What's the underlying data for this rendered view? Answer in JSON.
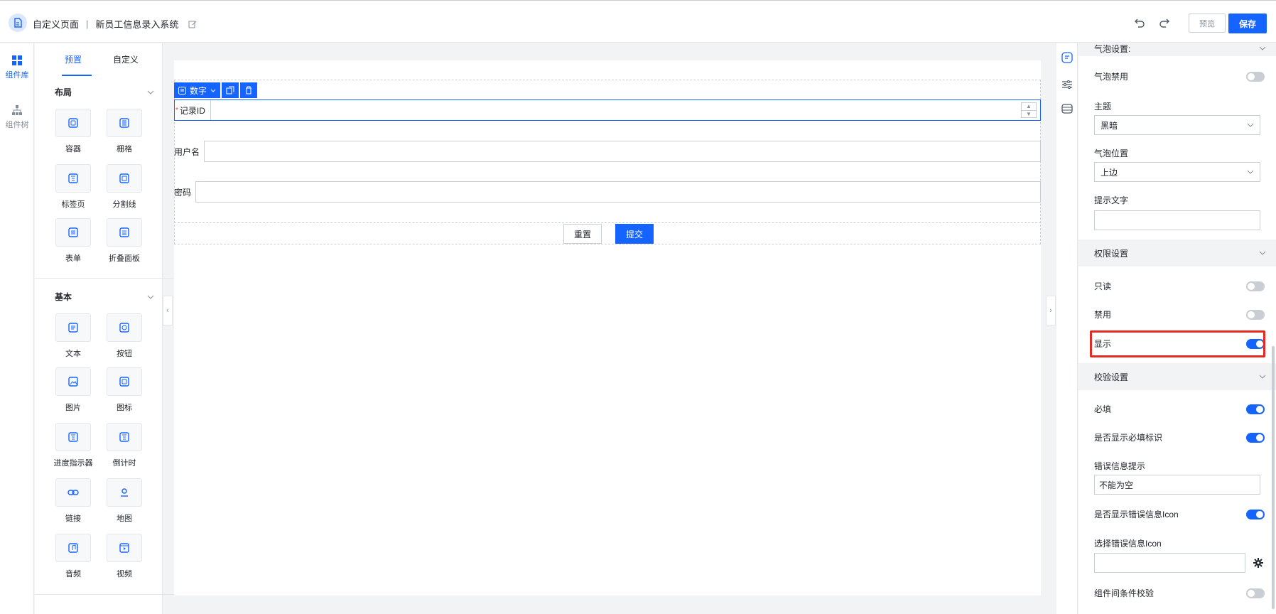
{
  "header": {
    "page_type": "自定义页面",
    "separator": "|",
    "system_name": "新员工信息录入系统",
    "preview_label": "预览",
    "save_label": "保存"
  },
  "left_rail": {
    "items": [
      {
        "label": "组件库",
        "icon": "grid-icon",
        "active": true
      },
      {
        "label": "组件树",
        "icon": "tree-icon",
        "active": false
      }
    ]
  },
  "palette": {
    "tabs": [
      "预置",
      "自定义"
    ],
    "sections": [
      {
        "title": "布局",
        "items": [
          {
            "label": "容器",
            "icon": "container-icon"
          },
          {
            "label": "栅格",
            "icon": "grid-columns-icon"
          },
          {
            "label": "标签页",
            "icon": "tabs-icon"
          },
          {
            "label": "分割线",
            "icon": "divider-icon"
          },
          {
            "label": "表单",
            "icon": "form-icon"
          },
          {
            "label": "折叠面板",
            "icon": "collapse-icon"
          }
        ]
      },
      {
        "title": "基本",
        "items": [
          {
            "label": "文本",
            "icon": "text-icon"
          },
          {
            "label": "按钮",
            "icon": "button-icon"
          },
          {
            "label": "图片",
            "icon": "image-icon"
          },
          {
            "label": "图标",
            "icon": "icon-icon"
          },
          {
            "label": "进度指示器",
            "icon": "progress-icon"
          },
          {
            "label": "倒计时",
            "icon": "countdown-icon"
          },
          {
            "label": "链接",
            "icon": "link-icon"
          },
          {
            "label": "地图",
            "icon": "map-icon"
          },
          {
            "label": "音频",
            "icon": "audio-icon"
          },
          {
            "label": "视频",
            "icon": "video-icon"
          }
        ]
      }
    ]
  },
  "canvas": {
    "toolbar": {
      "type_label": "数字"
    },
    "fields": [
      {
        "label": "记录ID",
        "required": true
      },
      {
        "label": "用户名"
      },
      {
        "label": "密码"
      }
    ],
    "reset_label": "重置",
    "submit_label": "提交"
  },
  "props": {
    "bubble_settings_label": "气泡设置:",
    "bubble_disabled_label": "气泡禁用",
    "bubble_disabled": false,
    "theme_label": "主题",
    "theme_value": "黑暗",
    "bubble_position_label": "气泡位置",
    "bubble_position_value": "上边",
    "hint_text_label": "提示文字",
    "hint_text_value": "",
    "permission_group": "权限设置",
    "readonly_label": "只读",
    "readonly": false,
    "disabled_label": "禁用",
    "disabled": false,
    "show_label": "显示",
    "show": true,
    "validation_group": "校验设置",
    "required_label": "必填",
    "required": true,
    "show_required_mark_label": "是否显示必填标识",
    "show_required_mark": true,
    "error_hint_label": "错误信息提示",
    "error_hint_value": "不能为空",
    "show_error_icon_label": "是否显示错误信息Icon",
    "show_error_icon": true,
    "choose_error_icon_label": "选择错误信息Icon",
    "choose_error_icon_value": "",
    "cross_field_validation_label": "组件间条件校验",
    "cross_field_validation": false
  },
  "colors": {
    "accent": "#1664ff",
    "highlight": "#e32a23"
  }
}
